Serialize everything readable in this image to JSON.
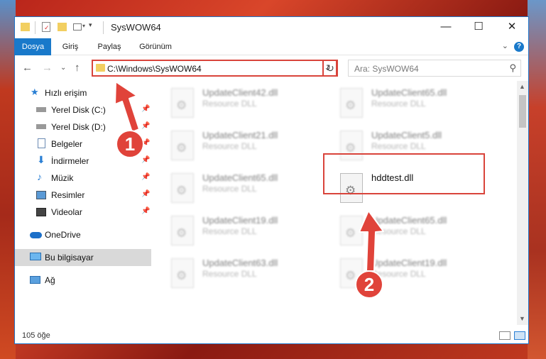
{
  "window": {
    "title": "SysWOW64"
  },
  "ribbon": {
    "tabs": [
      "Dosya",
      "Giriş",
      "Paylaş",
      "Görünüm"
    ]
  },
  "nav": {
    "address": "C:\\Windows\\SysWOW64",
    "search_placeholder": "Ara: SysWOW64"
  },
  "sidebar": {
    "items": [
      {
        "label": "Hızlı erişim",
        "icon": "star-icon"
      },
      {
        "label": "Yerel Disk (C:)",
        "icon": "drive-icon"
      },
      {
        "label": "Yerel Disk (D:)",
        "icon": "drive-icon"
      },
      {
        "label": "Belgeler",
        "icon": "document-icon"
      },
      {
        "label": "İndirmeler",
        "icon": "download-icon"
      },
      {
        "label": "Müzik",
        "icon": "music-icon"
      },
      {
        "label": "Resimler",
        "icon": "pictures-icon"
      },
      {
        "label": "Videolar",
        "icon": "video-icon"
      },
      {
        "label": "OneDrive",
        "icon": "cloud-icon"
      },
      {
        "label": "Bu bilgisayar",
        "icon": "computer-icon"
      },
      {
        "label": "Ağ",
        "icon": "network-icon"
      }
    ]
  },
  "files": [
    {
      "name": "UpdateClient42.dll",
      "type": "Resource DLL"
    },
    {
      "name": "UpdateClient65.dll",
      "type": "Resource DLL"
    },
    {
      "name": "UpdateClient21.dll",
      "type": "Resource DLL"
    },
    {
      "name": "UpdateClient5.dll",
      "type": "Resource DLL"
    },
    {
      "name": "UpdateClient65.dll",
      "type": "Resource DLL"
    },
    {
      "name": "hddtest.dll",
      "type": ""
    },
    {
      "name": "UpdateClient19.dll",
      "type": "Resource DLL"
    },
    {
      "name": "UpdateClient65.dll",
      "type": "Resource DLL"
    },
    {
      "name": "UpdateClient63.dll",
      "type": "Resource DLL"
    },
    {
      "name": "UpdateClient19.dll",
      "type": "Resource DLL"
    }
  ],
  "status": {
    "count": "105 öğe"
  },
  "annotations": {
    "step1": "1",
    "step2": "2",
    "color": "#e0433a"
  }
}
